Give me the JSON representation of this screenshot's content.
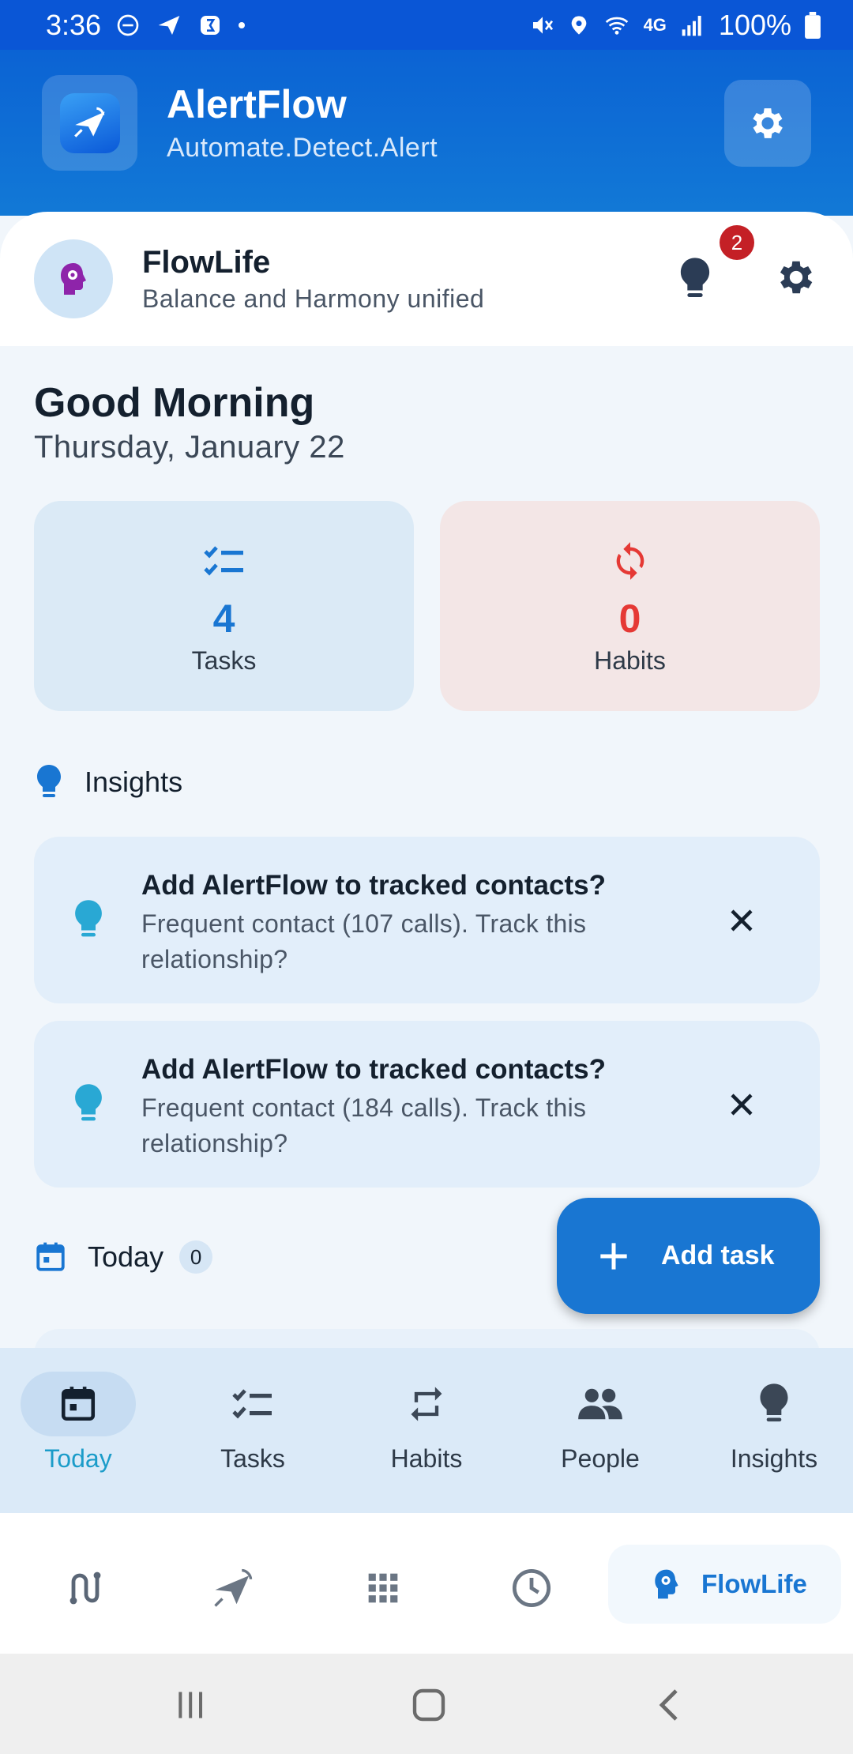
{
  "status_bar": {
    "time": "3:36",
    "battery": "100%",
    "network": "4G"
  },
  "app": {
    "title": "AlertFlow",
    "subtitle": "Automate.Detect.Alert"
  },
  "module": {
    "title": "FlowLife",
    "subtitle": "Balance and Harmony unified",
    "notification_count": "2"
  },
  "greeting": {
    "text": "Good Morning",
    "date": "Thursday, January 22"
  },
  "stats": {
    "tasks": {
      "value": "4",
      "label": "Tasks",
      "color": "#1976d2"
    },
    "habits": {
      "value": "0",
      "label": "Habits",
      "color": "#e53935"
    }
  },
  "insights": {
    "title": "Insights",
    "cards": [
      {
        "title": "Add AlertFlow to tracked contacts?",
        "description": "Frequent contact (107 calls). Track this relationship?"
      },
      {
        "title": "Add AlertFlow to tracked contacts?",
        "description": "Frequent contact (184 calls). Track this relationship?"
      }
    ]
  },
  "today": {
    "title": "Today",
    "count": "0"
  },
  "fab": {
    "label": "Add task"
  },
  "inner_nav": [
    {
      "label": "Today",
      "icon": "calendar-icon",
      "active": true
    },
    {
      "label": "Tasks",
      "icon": "checklist-icon",
      "active": false
    },
    {
      "label": "Habits",
      "icon": "repeat-icon",
      "active": false
    },
    {
      "label": "People",
      "icon": "people-icon",
      "active": false
    },
    {
      "label": "Insights",
      "icon": "bulb-icon",
      "active": false
    }
  ],
  "outer_nav": {
    "active_label": "FlowLife",
    "items": [
      "route-icon",
      "send-icon",
      "apps-grid-icon",
      "clock-icon",
      "flowlife-icon"
    ]
  },
  "colors": {
    "primary": "#1976d2",
    "header": "#0b63d4",
    "status_bar": "#0a56d6",
    "badge": "#c42026",
    "insight_icon": "#29a8d4"
  }
}
